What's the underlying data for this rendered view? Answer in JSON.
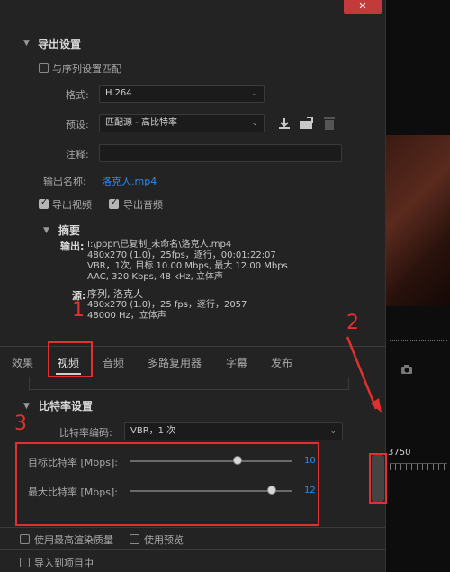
{
  "dialog": {
    "close_glyph": "✕",
    "export_settings": {
      "title": "导出设置",
      "match_sequence": "与序列设置匹配",
      "format_label": "格式:",
      "format_value": "H.264",
      "preset_label": "预设:",
      "preset_value": "匹配源 - 高比特率",
      "comment_label": "注释:",
      "comment_value": "",
      "output_name_label": "输出名称:",
      "output_name_value": "洛克人.mp4",
      "export_video_label": "导出视频",
      "export_video_checked": true,
      "export_audio_label": "导出音频",
      "export_audio_checked": true
    },
    "summary": {
      "title": "摘要",
      "output_label": "输出:",
      "output_lines": [
        "I:\\pppr\\已复制_未命名\\洛克人.mp4",
        "480x270 (1.0)，25fps，逐行，00:01:22:07",
        "VBR，1次, 目标 10.00 Mbps, 最大 12.00 Mbps",
        "AAC, 320 Kbps, 48  kHz, 立体声"
      ],
      "source_label": "源:",
      "source_lines": [
        "序列, 洛克人",
        "480x270 (1.0)，25 fps，逐行，2057",
        "48000 Hz，立体声"
      ]
    },
    "tabs": [
      "效果",
      "视频",
      "音频",
      "多路复用器",
      "字幕",
      "发布"
    ],
    "active_tab": "视频",
    "bitrate": {
      "title": "比特率设置",
      "encoding_label": "比特率编码:",
      "encoding_value": "VBR，1 次",
      "target_label": "目标比特率 [Mbps]:",
      "target_value": "10",
      "target_fraction": 0.66,
      "max_label": "最大比特率 [Mbps]:",
      "max_value": "12",
      "max_fraction": 0.87
    },
    "bottom": {
      "max_render_quality": "使用最高渲染质量",
      "use_previews": "使用预览",
      "import_to_project": "导入到项目中"
    }
  },
  "right_panel": {
    "timecode": "3750"
  },
  "annotations": {
    "number_1": "1",
    "number_2": "2",
    "number_3": "3",
    "color": "#e03030"
  }
}
